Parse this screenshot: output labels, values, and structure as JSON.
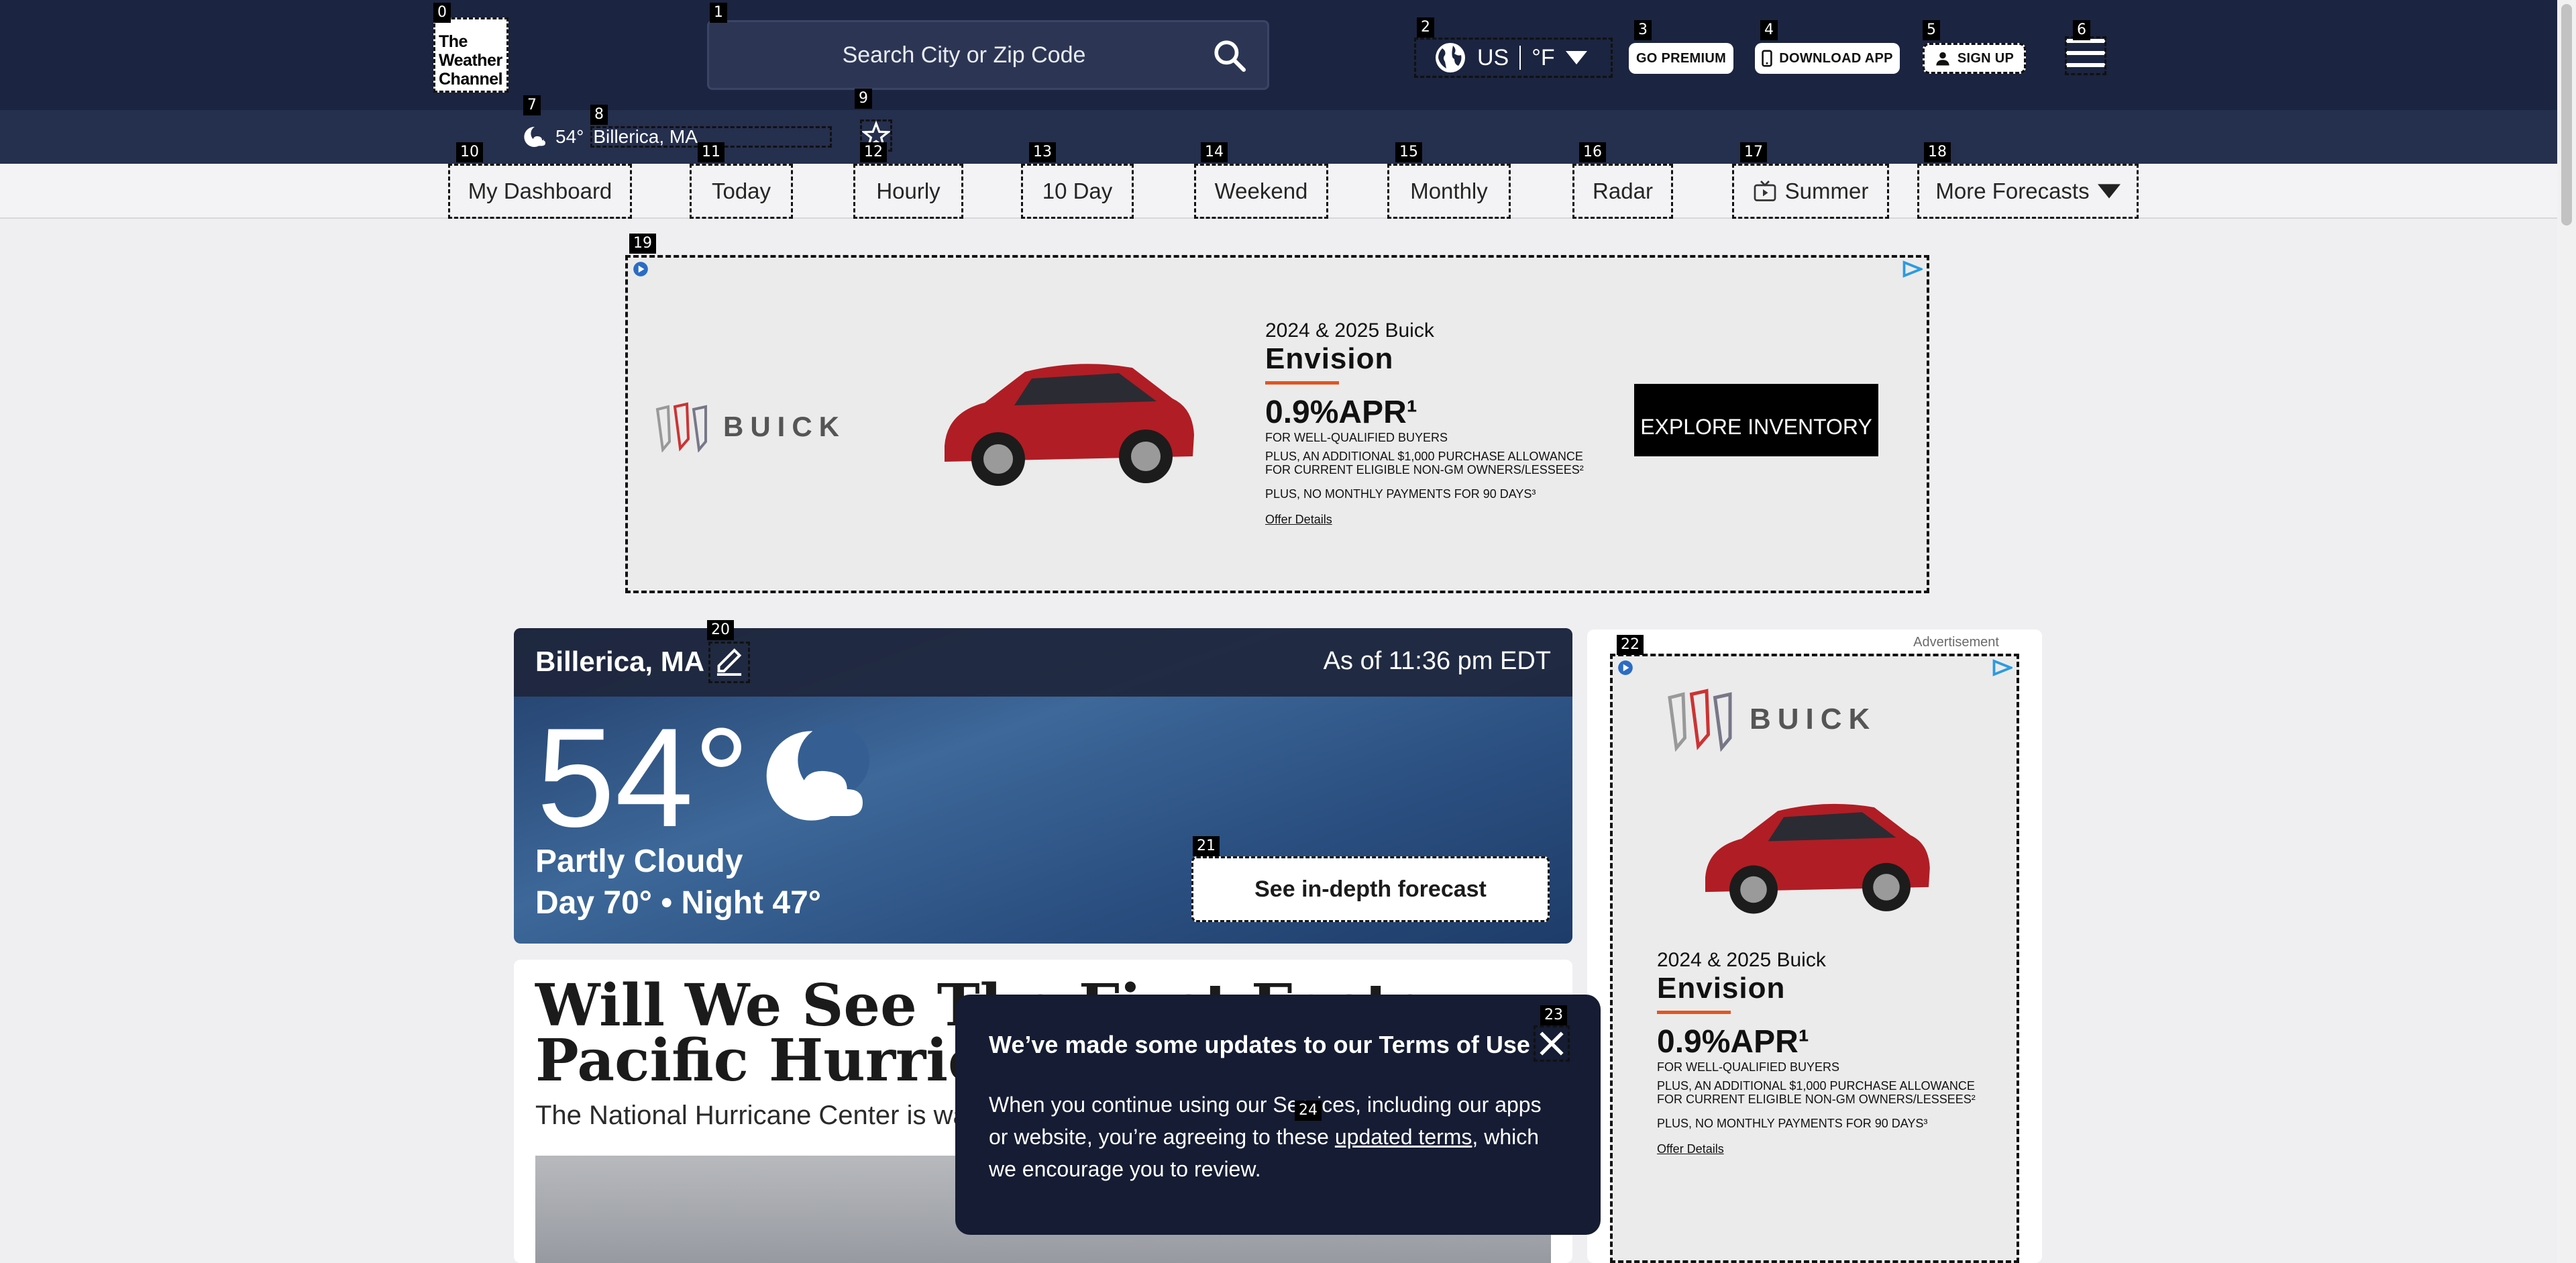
{
  "header": {
    "logo_lines": [
      "The",
      "Weather",
      "Channel"
    ],
    "search_placeholder": "Search City or Zip Code",
    "locale": {
      "region": "US",
      "unit": "°F"
    },
    "buttons": {
      "premium": "GO PREMIUM",
      "download": "DOWNLOAD APP",
      "signup": "SIGN UP"
    }
  },
  "recent_location": {
    "temp": "54°",
    "name": "Billerica, MA"
  },
  "nav": [
    {
      "label": "My Dashboard"
    },
    {
      "label": "Today"
    },
    {
      "label": "Hourly"
    },
    {
      "label": "10 Day"
    },
    {
      "label": "Weekend"
    },
    {
      "label": "Monthly"
    },
    {
      "label": "Radar"
    },
    {
      "label": "Summer"
    },
    {
      "label": "More Forecasts"
    }
  ],
  "ad": {
    "brand": "BUICK",
    "line1": "2024 & 2025 Buick",
    "model": "Envision",
    "apr": "0.9%APR¹",
    "buyers": "FOR WELL-QUALIFIED BUYERS",
    "allowance": "PLUS, AN ADDITIONAL $1,000 PURCHASE ALLOWANCE FOR CURRENT ELIGIBLE NON-GM OWNERS/LESSEES²",
    "payments": "PLUS, NO MONTHLY PAYMENTS FOR 90 DAYS³",
    "offer_link": "Offer Details",
    "cta": "EXPLORE INVENTORY",
    "side_label": "Advertisement"
  },
  "weather": {
    "location": "Billerica, MA",
    "as_of": "As of 11:36 pm EDT",
    "temperature": "54°",
    "phrase": "Partly Cloudy",
    "day_night": "Day 70° • Night 47°",
    "cta": "See in-depth forecast"
  },
  "article": {
    "title": "Will We See The First Eastern Pacific Hurricane This",
    "subtitle": "The National Hurricane Center is wa"
  },
  "toast": {
    "title": "We’ve made some updates to our Terms of Use",
    "body_before": "When you continue using our Services, including our apps or website, you’re agreeing to these ",
    "link": "updated terms",
    "body_after": ", which we encourage you to review."
  },
  "icons": [
    "search-icon",
    "globe-icon",
    "caret-down-icon",
    "phone-icon",
    "user-icon",
    "hamburger-menu-icon",
    "moon-cloud-icon",
    "star-icon",
    "edit-pencil-icon",
    "close-icon",
    "adchoices-icon",
    "tv-icon"
  ],
  "colors": {
    "header_bg": "#1b2440",
    "subbar_bg": "#252f4e",
    "toast_bg": "#151c33",
    "ad_red": "#e35520"
  }
}
